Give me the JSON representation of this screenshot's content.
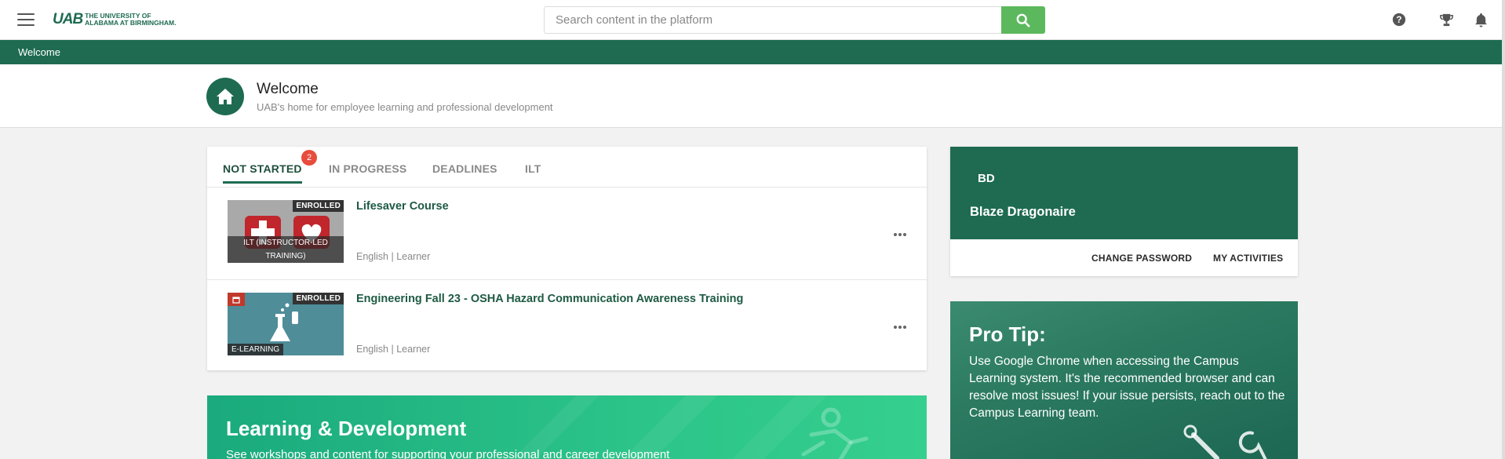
{
  "header": {
    "logo_mark": "UAB",
    "logo_line1": "THE UNIVERSITY OF",
    "logo_line2": "ALABAMA AT BIRMINGHAM.",
    "search_placeholder": "Search content in the platform",
    "icons": [
      "menu-icon",
      "search-icon",
      "help-icon",
      "trophy-icon",
      "bell-icon"
    ]
  },
  "breadcrumb": "Welcome",
  "page": {
    "title": "Welcome",
    "subtitle": "UAB's home for employee learning and professional development"
  },
  "tabs": [
    {
      "label": "NOT STARTED",
      "active": true,
      "badge": "2"
    },
    {
      "label": "IN PROGRESS"
    },
    {
      "label": "DEADLINES"
    },
    {
      "label": "ILT"
    }
  ],
  "courses": [
    {
      "title": "Lifesaver Course",
      "status": "ENROLLED",
      "type": "ILT (INSTRUCTOR-LED TRAINING)",
      "meta": "English | Learner"
    },
    {
      "title": "Engineering Fall 23 - OSHA Hazard Communication Awareness Training",
      "status": "ENROLLED",
      "type": "E-LEARNING",
      "meta": "English | Learner"
    }
  ],
  "banner": {
    "title": "Learning & Development",
    "subtitle": "See workshops and content for supporting your professional and career development"
  },
  "profile": {
    "initials": "BD",
    "name": "Blaze Dragonaire",
    "change_password": "CHANGE PASSWORD",
    "my_activities": "MY ACTIVITIES"
  },
  "protip": {
    "title": "Pro Tip:",
    "body": "Use Google Chrome when accessing the Campus Learning system. It's the recommended browser and can resolve most issues! If your issue persists, reach out to the Campus Learning team."
  },
  "colors": {
    "brand_green": "#1e6b52",
    "search_button": "#5cb85c",
    "badge_red": "#e74c3c"
  }
}
